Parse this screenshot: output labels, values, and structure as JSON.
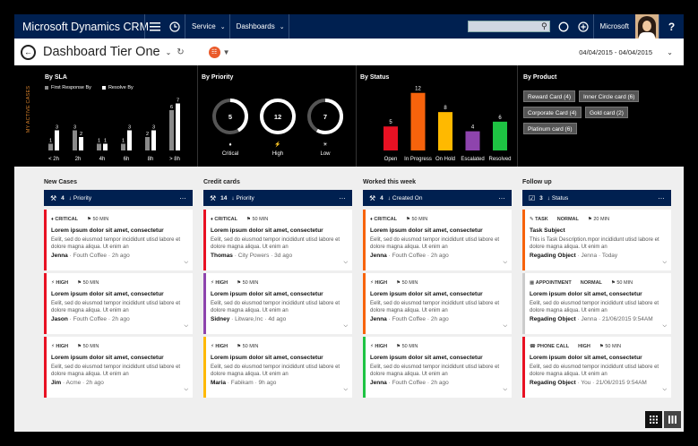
{
  "nav": {
    "brand": "Microsoft Dynamics CRM",
    "service": "Service",
    "dashboards": "Dashboards",
    "user": "Microsoft",
    "help": "?"
  },
  "titlebar": {
    "title": "Dashboard Tier One",
    "daterange": "04/04/2015 - 04/04/2015"
  },
  "charts": {
    "side_label": "MY ACTIVE CASES",
    "sla": {
      "title": "By SLA",
      "legend": [
        "First Response By",
        "Resolve By"
      ]
    },
    "priority": {
      "title": "By Priority"
    },
    "status": {
      "title": "By Status"
    },
    "product": {
      "title": "By Product",
      "chips": [
        "Reward Card (4)",
        "Inner Circle card (6)",
        "Corporate Card (4)",
        "Gold card (2)",
        "Platinum card (6)"
      ]
    }
  },
  "chart_data": [
    {
      "type": "bar",
      "title": "By SLA",
      "categories": [
        "< 2h",
        "2h",
        "4h",
        "6h",
        "8h",
        "> 8h"
      ],
      "series": [
        {
          "name": "First Response By",
          "values": [
            1,
            3,
            1,
            1,
            2,
            6
          ],
          "color": "#8a8a8a"
        },
        {
          "name": "Resolve By",
          "values": [
            3,
            2,
            1,
            3,
            3,
            7
          ],
          "color": "#ffffff"
        }
      ]
    },
    {
      "type": "pie",
      "title": "By Priority",
      "categories": [
        "Critical",
        "High",
        "Low"
      ],
      "values": [
        5,
        12,
        7
      ],
      "max": 12
    },
    {
      "type": "bar",
      "title": "By Status",
      "categories": [
        "Open",
        "In Progress",
        "On Hold",
        "Escalated",
        "Resolved"
      ],
      "values": [
        5,
        12,
        8,
        4,
        6
      ],
      "colors": [
        "#e81123",
        "#f7630c",
        "#ffb900",
        "#8e44ad",
        "#1ec343"
      ]
    }
  ],
  "columns": [
    {
      "title": "New Cases",
      "count": "4",
      "sort": "Priority",
      "cards": [
        {
          "type": "CRITICAL",
          "extra": "",
          "time": "50 MIN",
          "title": "Lorem ipsum dolor sit amet, consectetur",
          "desc": "Eelit, sed do eiusmod tempor incididunt utisd labore et dolore magna aliqua. Ut enim an",
          "name": "Jenna",
          "org": "Fouth Coffee",
          "when": "2h ago",
          "color": "#e81123"
        },
        {
          "type": "HIGH",
          "extra": "",
          "time": "50 MIN",
          "title": "Lorem ipsum dolor sit amet, consectetur",
          "desc": "Eelit, sed do eiusmod tempor incididunt utisd labore et dolore magna aliqua. Ut enim an",
          "name": "Jason",
          "org": "Fouth Coffee",
          "when": "2h ago",
          "color": "#e81123"
        },
        {
          "type": "HIGH",
          "extra": "",
          "time": "50 MIN",
          "title": "Lorem ipsum dolor sit amet, consectetur",
          "desc": "Eelit, sed do eiusmod tempor incididunt utisd labore et dolore magna aliqua. Ut enim an",
          "name": "Jim",
          "org": "Acme",
          "when": "2h ago",
          "color": "#e81123"
        }
      ]
    },
    {
      "title": "Credit cards",
      "count": "14",
      "sort": "Priority",
      "cards": [
        {
          "type": "CRITICAL",
          "extra": "",
          "time": "50 MIN",
          "title": "Lorem ipsum dolor sit amet, consectetur",
          "desc": "Eelit, sed do eiusmod tempor incididunt utisd labore et dolore magna aliqua. Ut enim an",
          "name": "Thomas",
          "org": "City Powers",
          "when": "3d ago",
          "color": "#e81123"
        },
        {
          "type": "HIGH",
          "extra": "",
          "time": "50 MIN",
          "title": "Lorem ipsum dolor sit amet, consectetur",
          "desc": "Eelit, sed do eiusmod tempor incididunt utisd labore et dolore magna aliqua. Ut enim an",
          "name": "Sidney",
          "org": "Litware,Inc",
          "when": "4d ago",
          "color": "#8e44ad"
        },
        {
          "type": "HIGH",
          "extra": "",
          "time": "50 MIN",
          "title": "Lorem ipsum dolor sit amet, consectetur",
          "desc": "Eelit, sed do eiusmod tempor incididunt utisd labore et dolore magna aliqua. Ut enim an",
          "name": "Maria",
          "org": "Fabikam",
          "when": "9h ago",
          "color": "#ffb900"
        }
      ]
    },
    {
      "title": "Worked this week",
      "count": "4",
      "sort": "Created On",
      "cards": [
        {
          "type": "CRITICAL",
          "extra": "",
          "time": "50 MIN",
          "title": "Lorem ipsum dolor sit amet, consectetur",
          "desc": "Eelit, sed do eiusmod tempor incididunt utisd labore et dolore magna aliqua. Ut enim an",
          "name": "Jenna",
          "org": "Fouth Coffee",
          "when": "2h ago",
          "color": "#f7630c"
        },
        {
          "type": "HIGH",
          "extra": "",
          "time": "50 MIN",
          "title": "Lorem ipsum dolor sit amet, consectetur",
          "desc": "Eelit, sed do eiusmod tempor incididunt utisd labore et dolore magna aliqua. Ut enim an",
          "name": "Jenna",
          "org": "Fouth Coffee",
          "when": "2h ago",
          "color": "#f7630c"
        },
        {
          "type": "HIGH",
          "extra": "",
          "time": "50 MIN",
          "title": "Lorem ipsum dolor sit amet, consectetur",
          "desc": "Eelit, sed do eiusmod tempor incididunt utisd labore et dolore magna aliqua. Ut enim an",
          "name": "Jenna",
          "org": "Fouth Coffee",
          "when": "2h ago",
          "color": "#1ec343"
        }
      ]
    },
    {
      "title": "Follow up",
      "count": "3",
      "sort": "Status",
      "cards": [
        {
          "type": "TASK",
          "extra": "NORMAL",
          "time": "20 MIN",
          "title": "Task Subject",
          "desc": "This is Task Description.mpor incididunt utisd labore et dolore magna aliqua. Ut enim an",
          "name": "Regading Object",
          "org": "Jenna",
          "when": "Today",
          "color": "#f7630c"
        },
        {
          "type": "APPOINTMENT",
          "extra": "NORMAL",
          "time": "50 MIN",
          "title": "Lorem ipsum dolor sit amet, consectetur",
          "desc": "Eelit, sed do eiusmod tempor incididunt utisd labore et dolore magna aliqua. Ut enim an",
          "name": "Regading Object",
          "org": "Jenna",
          "when": "21/06/2015 9:54AM",
          "color": "#cccccc"
        },
        {
          "type": "PHONE CALL",
          "extra": "HIGH",
          "time": "50 MIN",
          "title": "Lorem ipsum dolor sit amet, consectetur",
          "desc": "Eelit, sed do eiusmod tempor incididunt utisd labore et dolore magna aliqua. Ut enim an",
          "name": "Regading Object",
          "org": "You",
          "when": "21/06/2015 9:54AM",
          "color": "#e81123"
        }
      ]
    }
  ]
}
